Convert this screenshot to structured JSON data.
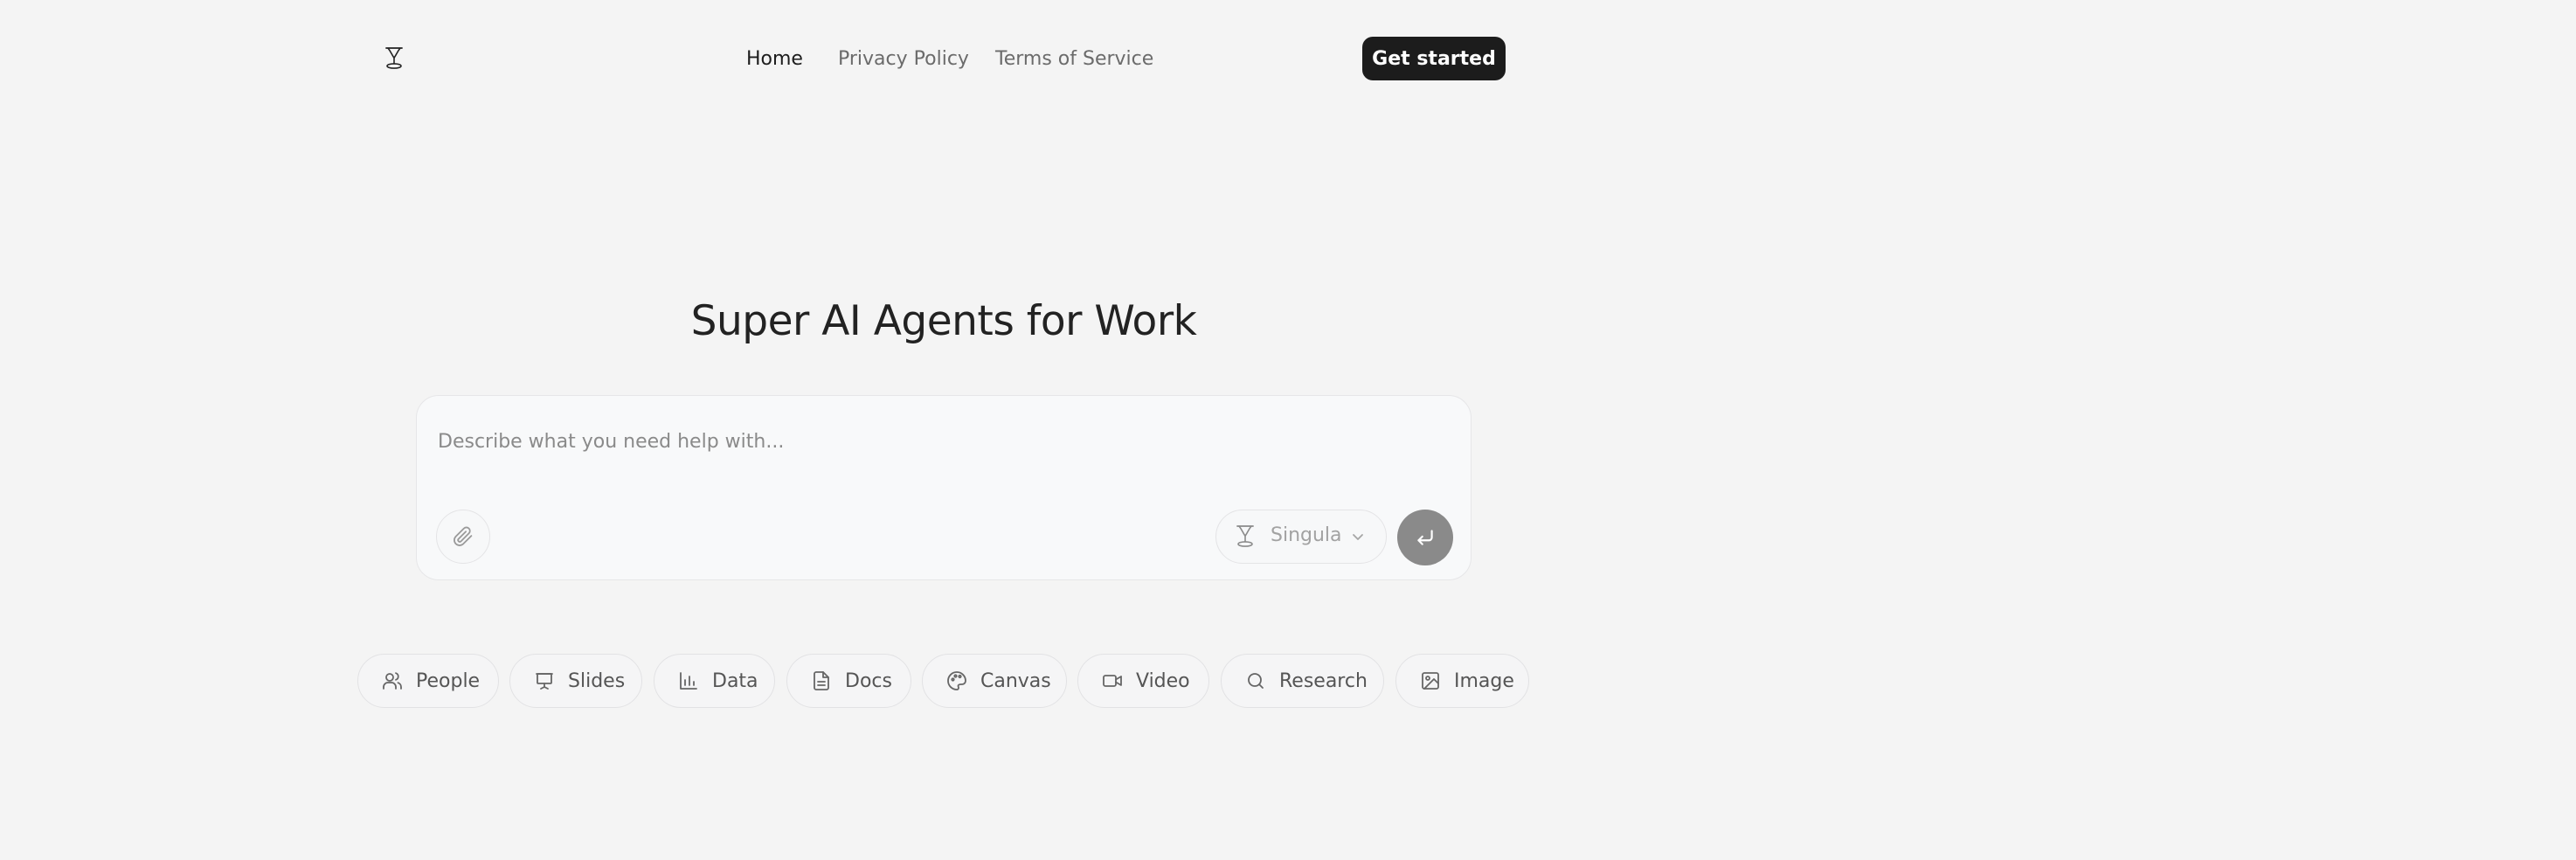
{
  "header": {
    "nav": [
      {
        "label": "Home",
        "active": true
      },
      {
        "label": "Privacy Policy",
        "active": false
      },
      {
        "label": "Terms of Service",
        "active": false
      }
    ],
    "cta_label": "Get started",
    "logo_icon": "singula-logo-icon"
  },
  "hero": {
    "title": "Super AI Agents for Work"
  },
  "prompt": {
    "placeholder": "Describe what you need help with...",
    "value": "",
    "attach_icon": "paperclip-icon",
    "model": {
      "label": "Singula",
      "icon": "singula-logo-icon",
      "chevron_icon": "chevron-down-icon"
    },
    "send_icon": "enter-return-icon",
    "send_color": "#8a8a8a"
  },
  "chips": [
    {
      "label": "People",
      "icon": "users-icon"
    },
    {
      "label": "Slides",
      "icon": "presentation-icon"
    },
    {
      "label": "Data",
      "icon": "bar-chart-icon"
    },
    {
      "label": "Docs",
      "icon": "document-icon"
    },
    {
      "label": "Canvas",
      "icon": "palette-icon"
    },
    {
      "label": "Video",
      "icon": "video-camera-icon"
    },
    {
      "label": "Research",
      "icon": "search-icon"
    },
    {
      "label": "Image",
      "icon": "image-icon"
    }
  ],
  "colors": {
    "background": "#f4f4f4",
    "cta_background": "#1c1c1c",
    "text_primary": "#1d1d1d",
    "text_muted": "#6b6b6b"
  }
}
